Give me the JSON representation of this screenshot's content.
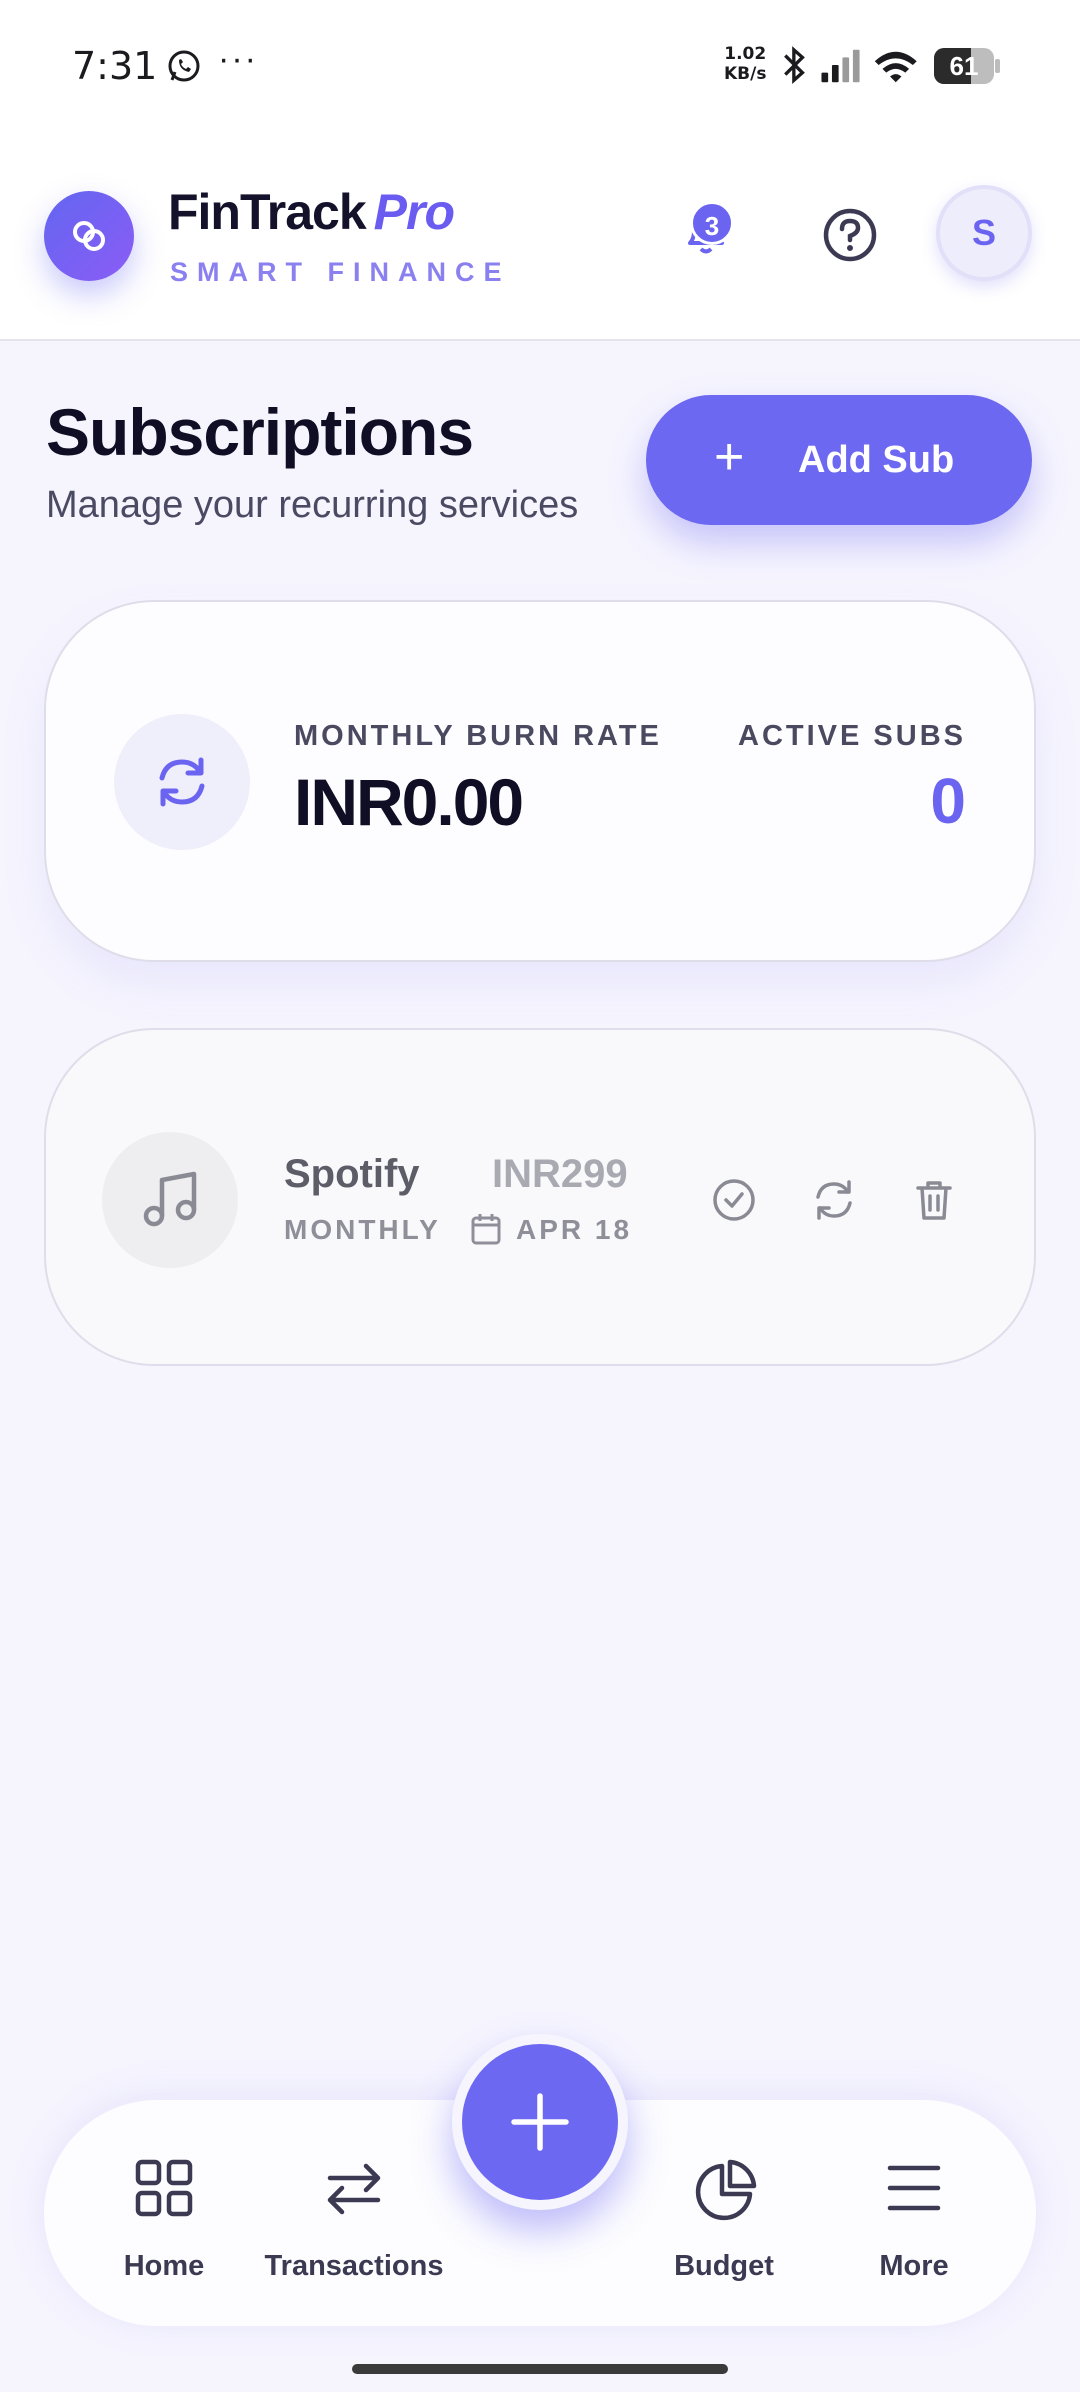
{
  "status_bar": {
    "time": "7:31",
    "more": "···",
    "net_speed_value": "1.02",
    "net_speed_unit": "KB/s",
    "battery_level": "61",
    "icons": [
      "whatsapp-icon",
      "bluetooth-icon",
      "signal-icon",
      "wifi-icon",
      "battery-icon"
    ]
  },
  "header": {
    "brand_name": "FinTrack",
    "brand_suffix": "Pro",
    "tagline": "SMART FINANCE",
    "notification_count": "3",
    "avatar_initial": "S"
  },
  "page": {
    "title": "Subscriptions",
    "subtitle": "Manage your recurring services",
    "add_button_label": "Add Sub"
  },
  "summary": {
    "burn_rate_label": "MONTHLY BURN RATE",
    "burn_rate_value": "INR0.00",
    "active_label": "ACTIVE SUBS",
    "active_value": "0"
  },
  "subscriptions": [
    {
      "name": "Spotify",
      "price": "INR299",
      "cycle": "MONTHLY",
      "next_date": "APR 18",
      "icon": "music-icon"
    }
  ],
  "bottom_nav": {
    "items": [
      {
        "label": "Home",
        "icon": "grid-icon"
      },
      {
        "label": "Transactions",
        "icon": "arrows-icon"
      },
      {
        "label": "Budget",
        "icon": "pie-chart-icon"
      },
      {
        "label": "More",
        "icon": "menu-icon"
      }
    ],
    "fab_icon": "plus-icon"
  },
  "colors": {
    "accent": "#6c68f2",
    "background": "#f6f5fe",
    "text_dark": "#0f0e24"
  }
}
